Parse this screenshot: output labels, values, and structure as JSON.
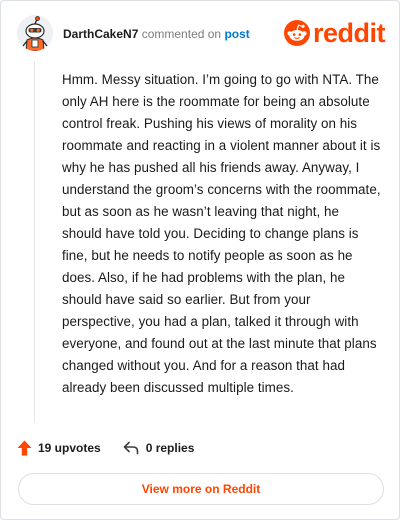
{
  "header": {
    "username": "DarthCakeN7",
    "action_text": "commented on",
    "post_link": "post",
    "brand_name": "reddit",
    "brand_color": "#ff4500"
  },
  "comment": {
    "body": "Hmm. Messy situation. I’m going to go with NTA. The only AH here is the roommate for being an absolute control freak. Pushing his views of morality on his roommate and reacting in a violent manner about it is why he has pushed all his friends away. Anyway, I understand the groom’s concerns with the roommate, but as soon as he wasn’t leaving that night, he should have told you. Deciding to change plans is fine, but he needs to notify people as soon as he does. Also, if he had problems with the plan, he should have said so earlier. But from your perspective, you had a plan, talked it through with everyone, and found out at the last minute that plans changed without you. And for a reason that had already been discussed multiple times."
  },
  "actions": {
    "upvotes": "19 upvotes",
    "replies": "0 replies",
    "upvote_icon": "upvote-arrow-icon",
    "reply_icon": "reply-arrow-icon"
  },
  "footer": {
    "view_more": "View more on Reddit"
  }
}
